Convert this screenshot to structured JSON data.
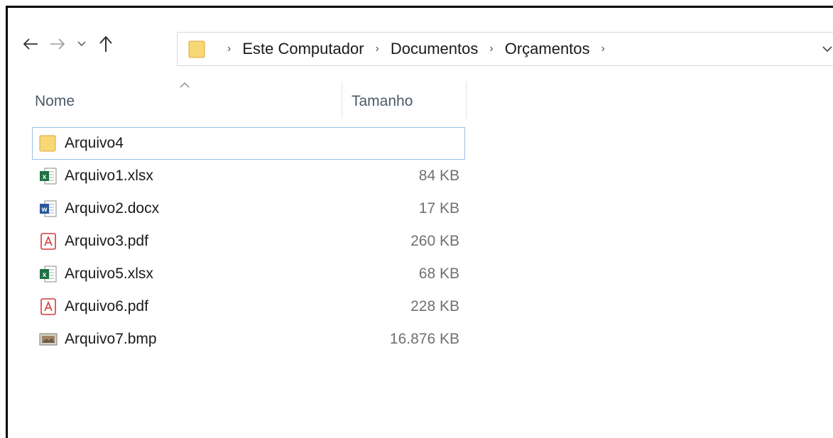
{
  "navigation": {
    "back_icon": "arrow-left-icon",
    "forward_icon": "arrow-right-icon",
    "recent_icon": "chevron-down-icon",
    "up_icon": "arrow-up-icon"
  },
  "address_bar": {
    "breadcrumbs": [
      "Este Computador",
      "Documentos",
      "Orçamentos"
    ]
  },
  "columns": {
    "name": "Nome",
    "size": "Tamanho"
  },
  "files": [
    {
      "name": "Arquivo4",
      "size": "",
      "icon": "folder-icon",
      "selected": true
    },
    {
      "name": "Arquivo1.xlsx",
      "size": "84 KB",
      "icon": "excel-file-icon"
    },
    {
      "name": "Arquivo2.docx",
      "size": "17 KB",
      "icon": "word-file-icon"
    },
    {
      "name": "Arquivo3.pdf",
      "size": "260 KB",
      "icon": "pdf-file-icon"
    },
    {
      "name": "Arquivo5.xlsx",
      "size": "68 KB",
      "icon": "excel-file-icon"
    },
    {
      "name": "Arquivo6.pdf",
      "size": "228 KB",
      "icon": "pdf-file-icon"
    },
    {
      "name": "Arquivo7.bmp",
      "size": "16.876 KB",
      "icon": "bitmap-file-icon"
    }
  ],
  "colors": {
    "folder": "#f8d775",
    "excel": "#1f7244",
    "word": "#2b579a",
    "pdf": "#d33b3b",
    "selection_border": "#99c0e6"
  }
}
